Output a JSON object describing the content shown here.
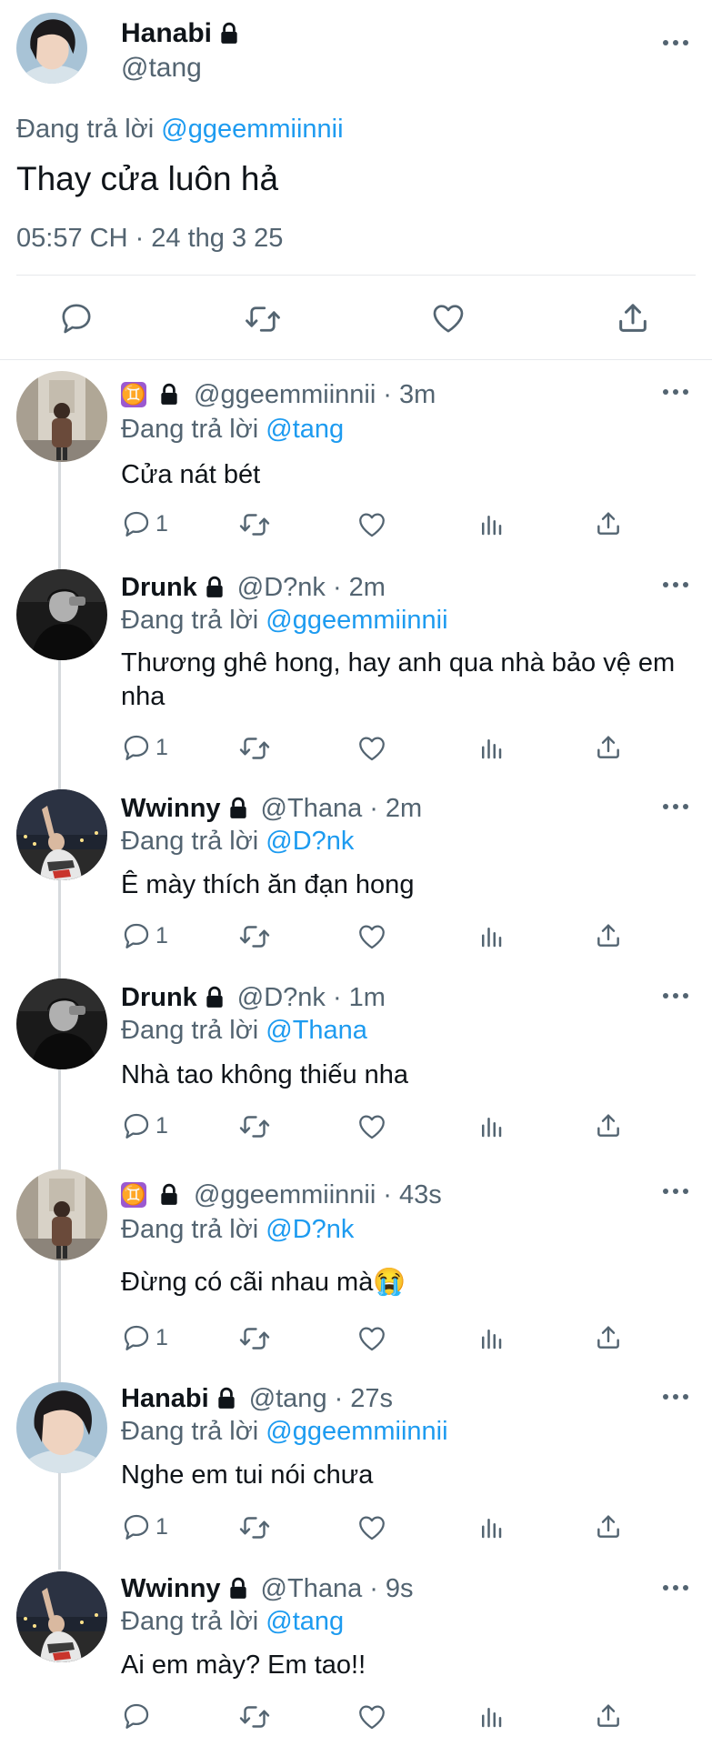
{
  "main_tweet": {
    "display_name": "Hanabi",
    "handle": "@tang",
    "reply_prefix": "Đang trả lời",
    "reply_to": "@ggeemmiinnii",
    "text": "Thay cửa luôn hả",
    "timestamp": "05:57 CH · 24 thg 3 25"
  },
  "action_icons": [
    "comment-icon",
    "retweet-icon",
    "like-icon",
    "share-icon"
  ],
  "replies": [
    {
      "display_name": "",
      "badge": "♊",
      "handle": "@ggeemmiinnii",
      "time": "· 3m",
      "reply_to": "@tang",
      "text": "Cửa nát bét",
      "reply_count": "1"
    },
    {
      "display_name": "Drunk",
      "handle": "@D?nk",
      "time": "· 2m",
      "reply_to": "@ggeemmiinnii",
      "text": "Thương ghê hong, hay anh qua nhà bảo vệ em nha",
      "reply_count": "1"
    },
    {
      "display_name": "Wwinny",
      "handle": "@Thana",
      "time": "· 2m",
      "reply_to": "@D?nk",
      "text": "Ê mày thích ăn đạn hong",
      "reply_count": "1"
    },
    {
      "display_name": "Drunk",
      "handle": "@D?nk",
      "time": "· 1m",
      "reply_to": "@Thana",
      "text": "Nhà tao không thiếu nha",
      "reply_count": "1"
    },
    {
      "display_name": "",
      "badge": "♊",
      "handle": "@ggeemmiinnii",
      "time": "· 43s",
      "reply_to": "@D?nk",
      "text": "Đừng có cãi nhau mà😭",
      "reply_count": "1"
    },
    {
      "display_name": "Hanabi",
      "handle": "@tang",
      "time": "· 27s",
      "reply_to": "@ggeemmiinnii",
      "text": "Nghe em tui nói chưa",
      "reply_count": "1"
    },
    {
      "display_name": "Wwinny",
      "handle": "@Thana",
      "time": "· 9s",
      "reply_to": "@tang",
      "text": "Ai em mày? Em tao!!",
      "reply_count": ""
    }
  ],
  "colors": {
    "link": "#1d9bf0",
    "secondary": "#536471",
    "text": "#0f1419",
    "divider": "#e6e9ec"
  }
}
